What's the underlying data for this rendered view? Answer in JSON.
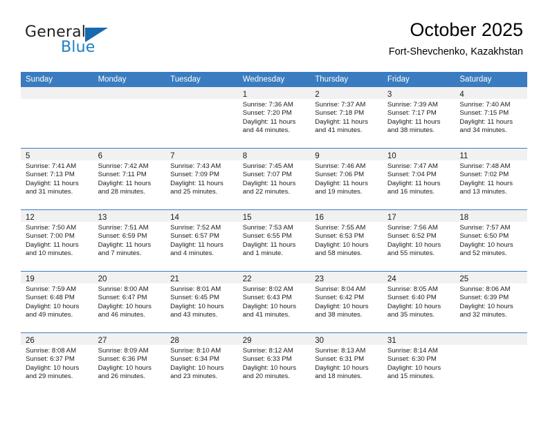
{
  "logo": {
    "word_top": "General",
    "word_bottom": "Blue",
    "triangle_icon": "triangle-icon",
    "colors": {
      "dark": "#231f20",
      "blue": "#1c7fc4",
      "triangle": "#1769b0"
    }
  },
  "header": {
    "title": "October 2025",
    "subtitle": "Fort-Shevchenko, Kazakhstan"
  },
  "theme": {
    "header_bg": "#3a7cbf",
    "header_text": "#ffffff",
    "daynum_bg": "#f1f1f1",
    "cell_bg": "#ffffff",
    "row_border": "#3a7cbf"
  },
  "weekdays": [
    "Sunday",
    "Monday",
    "Tuesday",
    "Wednesday",
    "Thursday",
    "Friday",
    "Saturday"
  ],
  "weeks": [
    [
      {
        "day": ""
      },
      {
        "day": ""
      },
      {
        "day": ""
      },
      {
        "day": "1",
        "sunrise": "Sunrise: 7:36 AM",
        "sunset": "Sunset: 7:20 PM",
        "daylight1": "Daylight: 11 hours",
        "daylight2": "and 44 minutes."
      },
      {
        "day": "2",
        "sunrise": "Sunrise: 7:37 AM",
        "sunset": "Sunset: 7:18 PM",
        "daylight1": "Daylight: 11 hours",
        "daylight2": "and 41 minutes."
      },
      {
        "day": "3",
        "sunrise": "Sunrise: 7:39 AM",
        "sunset": "Sunset: 7:17 PM",
        "daylight1": "Daylight: 11 hours",
        "daylight2": "and 38 minutes."
      },
      {
        "day": "4",
        "sunrise": "Sunrise: 7:40 AM",
        "sunset": "Sunset: 7:15 PM",
        "daylight1": "Daylight: 11 hours",
        "daylight2": "and 34 minutes."
      }
    ],
    [
      {
        "day": "5",
        "sunrise": "Sunrise: 7:41 AM",
        "sunset": "Sunset: 7:13 PM",
        "daylight1": "Daylight: 11 hours",
        "daylight2": "and 31 minutes."
      },
      {
        "day": "6",
        "sunrise": "Sunrise: 7:42 AM",
        "sunset": "Sunset: 7:11 PM",
        "daylight1": "Daylight: 11 hours",
        "daylight2": "and 28 minutes."
      },
      {
        "day": "7",
        "sunrise": "Sunrise: 7:43 AM",
        "sunset": "Sunset: 7:09 PM",
        "daylight1": "Daylight: 11 hours",
        "daylight2": "and 25 minutes."
      },
      {
        "day": "8",
        "sunrise": "Sunrise: 7:45 AM",
        "sunset": "Sunset: 7:07 PM",
        "daylight1": "Daylight: 11 hours",
        "daylight2": "and 22 minutes."
      },
      {
        "day": "9",
        "sunrise": "Sunrise: 7:46 AM",
        "sunset": "Sunset: 7:06 PM",
        "daylight1": "Daylight: 11 hours",
        "daylight2": "and 19 minutes."
      },
      {
        "day": "10",
        "sunrise": "Sunrise: 7:47 AM",
        "sunset": "Sunset: 7:04 PM",
        "daylight1": "Daylight: 11 hours",
        "daylight2": "and 16 minutes."
      },
      {
        "day": "11",
        "sunrise": "Sunrise: 7:48 AM",
        "sunset": "Sunset: 7:02 PM",
        "daylight1": "Daylight: 11 hours",
        "daylight2": "and 13 minutes."
      }
    ],
    [
      {
        "day": "12",
        "sunrise": "Sunrise: 7:50 AM",
        "sunset": "Sunset: 7:00 PM",
        "daylight1": "Daylight: 11 hours",
        "daylight2": "and 10 minutes."
      },
      {
        "day": "13",
        "sunrise": "Sunrise: 7:51 AM",
        "sunset": "Sunset: 6:59 PM",
        "daylight1": "Daylight: 11 hours",
        "daylight2": "and 7 minutes."
      },
      {
        "day": "14",
        "sunrise": "Sunrise: 7:52 AM",
        "sunset": "Sunset: 6:57 PM",
        "daylight1": "Daylight: 11 hours",
        "daylight2": "and 4 minutes."
      },
      {
        "day": "15",
        "sunrise": "Sunrise: 7:53 AM",
        "sunset": "Sunset: 6:55 PM",
        "daylight1": "Daylight: 11 hours",
        "daylight2": "and 1 minute."
      },
      {
        "day": "16",
        "sunrise": "Sunrise: 7:55 AM",
        "sunset": "Sunset: 6:53 PM",
        "daylight1": "Daylight: 10 hours",
        "daylight2": "and 58 minutes."
      },
      {
        "day": "17",
        "sunrise": "Sunrise: 7:56 AM",
        "sunset": "Sunset: 6:52 PM",
        "daylight1": "Daylight: 10 hours",
        "daylight2": "and 55 minutes."
      },
      {
        "day": "18",
        "sunrise": "Sunrise: 7:57 AM",
        "sunset": "Sunset: 6:50 PM",
        "daylight1": "Daylight: 10 hours",
        "daylight2": "and 52 minutes."
      }
    ],
    [
      {
        "day": "19",
        "sunrise": "Sunrise: 7:59 AM",
        "sunset": "Sunset: 6:48 PM",
        "daylight1": "Daylight: 10 hours",
        "daylight2": "and 49 minutes."
      },
      {
        "day": "20",
        "sunrise": "Sunrise: 8:00 AM",
        "sunset": "Sunset: 6:47 PM",
        "daylight1": "Daylight: 10 hours",
        "daylight2": "and 46 minutes."
      },
      {
        "day": "21",
        "sunrise": "Sunrise: 8:01 AM",
        "sunset": "Sunset: 6:45 PM",
        "daylight1": "Daylight: 10 hours",
        "daylight2": "and 43 minutes."
      },
      {
        "day": "22",
        "sunrise": "Sunrise: 8:02 AM",
        "sunset": "Sunset: 6:43 PM",
        "daylight1": "Daylight: 10 hours",
        "daylight2": "and 41 minutes."
      },
      {
        "day": "23",
        "sunrise": "Sunrise: 8:04 AM",
        "sunset": "Sunset: 6:42 PM",
        "daylight1": "Daylight: 10 hours",
        "daylight2": "and 38 minutes."
      },
      {
        "day": "24",
        "sunrise": "Sunrise: 8:05 AM",
        "sunset": "Sunset: 6:40 PM",
        "daylight1": "Daylight: 10 hours",
        "daylight2": "and 35 minutes."
      },
      {
        "day": "25",
        "sunrise": "Sunrise: 8:06 AM",
        "sunset": "Sunset: 6:39 PM",
        "daylight1": "Daylight: 10 hours",
        "daylight2": "and 32 minutes."
      }
    ],
    [
      {
        "day": "26",
        "sunrise": "Sunrise: 8:08 AM",
        "sunset": "Sunset: 6:37 PM",
        "daylight1": "Daylight: 10 hours",
        "daylight2": "and 29 minutes."
      },
      {
        "day": "27",
        "sunrise": "Sunrise: 8:09 AM",
        "sunset": "Sunset: 6:36 PM",
        "daylight1": "Daylight: 10 hours",
        "daylight2": "and 26 minutes."
      },
      {
        "day": "28",
        "sunrise": "Sunrise: 8:10 AM",
        "sunset": "Sunset: 6:34 PM",
        "daylight1": "Daylight: 10 hours",
        "daylight2": "and 23 minutes."
      },
      {
        "day": "29",
        "sunrise": "Sunrise: 8:12 AM",
        "sunset": "Sunset: 6:33 PM",
        "daylight1": "Daylight: 10 hours",
        "daylight2": "and 20 minutes."
      },
      {
        "day": "30",
        "sunrise": "Sunrise: 8:13 AM",
        "sunset": "Sunset: 6:31 PM",
        "daylight1": "Daylight: 10 hours",
        "daylight2": "and 18 minutes."
      },
      {
        "day": "31",
        "sunrise": "Sunrise: 8:14 AM",
        "sunset": "Sunset: 6:30 PM",
        "daylight1": "Daylight: 10 hours",
        "daylight2": "and 15 minutes."
      },
      {
        "day": ""
      }
    ]
  ]
}
